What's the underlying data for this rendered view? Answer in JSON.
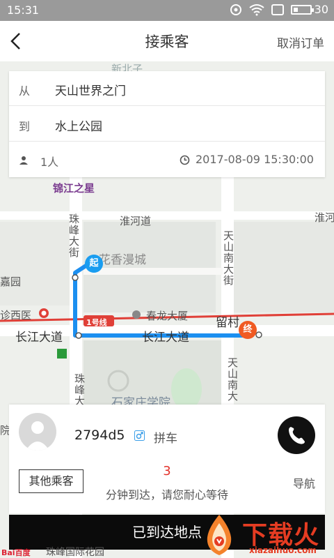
{
  "status_bar": {
    "time": "15:31",
    "battery": "30",
    "battery_level": 0.3
  },
  "header": {
    "title": "接乘客",
    "cancel_label": "取消订单"
  },
  "trip": {
    "from_label": "从",
    "from_value": "天山世界之门",
    "to_label": "到",
    "to_value": "水上公园",
    "passenger_count": "1人",
    "datetime": "2017-08-09 15:30:00"
  },
  "map": {
    "labels": {
      "jinjiang": "锦江之星",
      "huaihe": "淮河道",
      "huaihe_right": "淮河",
      "zhufeng_top": "珠峰大街",
      "tianshan_top": "天山南大街",
      "huaxiang": "花香漫城",
      "jiayuan": "嘉园",
      "zhenxiyi": "诊西医",
      "chunlong": "春龙大厦",
      "liucun": "留村",
      "changjiang_left": "长江大道",
      "changjiang_right": "长江大道",
      "line1": "1号线",
      "zhufeng_bottom": "珠峰大",
      "tianshan_bottom": "天山南大",
      "xueyuan": "石家庄学院",
      "yuan": "院",
      "bottom_road": "珠峰国际花园",
      "baidu": "Bai百度"
    },
    "start_marker": "起",
    "end_marker": "终",
    "colors": {
      "route": "#1c8ff0",
      "start": "#1a9df0",
      "end": "#f05a22",
      "metro": "#e04038"
    }
  },
  "passenger": {
    "plate": "2794d5",
    "carpool_label": "拼车",
    "other_label": "其他乘客",
    "eta_minutes": "3",
    "eta_text": "分钟到达，请您耐心等待",
    "nav_label": "导航"
  },
  "arrive_label": "已到达地点",
  "watermark": {
    "text": "下载火",
    "sub": "xiazaihuo.com"
  }
}
